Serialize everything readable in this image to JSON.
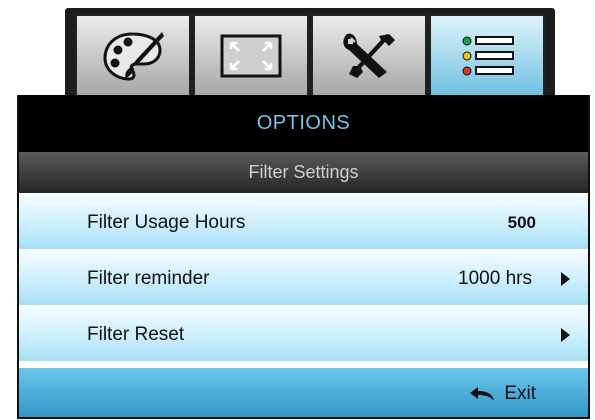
{
  "tabs": [
    {
      "name": "image",
      "icon": "palette-icon",
      "active": false
    },
    {
      "name": "display",
      "icon": "screen-resize-icon",
      "active": false
    },
    {
      "name": "setup",
      "icon": "tools-icon",
      "active": false
    },
    {
      "name": "options",
      "icon": "options-list-icon",
      "active": true
    }
  ],
  "menu": {
    "title": "OPTIONS",
    "subtitle": "Filter Settings",
    "rows": [
      {
        "label": "Filter Usage Hours",
        "value": "500",
        "has_arrow": false
      },
      {
        "label": "Filter reminder",
        "value": "1000 hrs",
        "has_arrow": true
      },
      {
        "label": "Filter Reset",
        "value": "",
        "has_arrow": true
      }
    ],
    "exit_label": "Exit"
  },
  "colors": {
    "title_text": "#73c5ea",
    "row_gradient_top": "#f1fbff",
    "row_gradient_bottom": "#a6def4",
    "footer_top": "#6cc6ea",
    "footer_bottom": "#2f95c8",
    "active_tab": "#6fc0e1"
  }
}
